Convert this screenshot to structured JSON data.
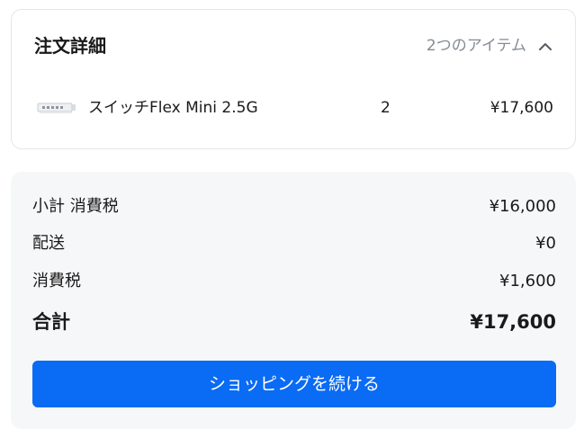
{
  "order_details": {
    "title": "注文詳細",
    "item_count_label": "2つのアイテム",
    "items": [
      {
        "name": "スイッチFlex Mini 2.5G",
        "quantity": "2",
        "price": "¥17,600",
        "thumbnail_icon": "network-switch-icon"
      }
    ]
  },
  "summary": {
    "subtotal_label": "小計 消費税",
    "subtotal_value": "¥16,000",
    "shipping_label": "配送",
    "shipping_value": "¥0",
    "tax_label": "消費税",
    "tax_value": "¥1,600",
    "total_label": "合計",
    "total_value": "¥17,600"
  },
  "continue_button_label": "ショッピングを続ける",
  "colors": {
    "accent": "#0a6bf4",
    "muted_text": "#858b94",
    "summary_background": "#f6f7f8",
    "card_border": "#e4e6ea"
  }
}
